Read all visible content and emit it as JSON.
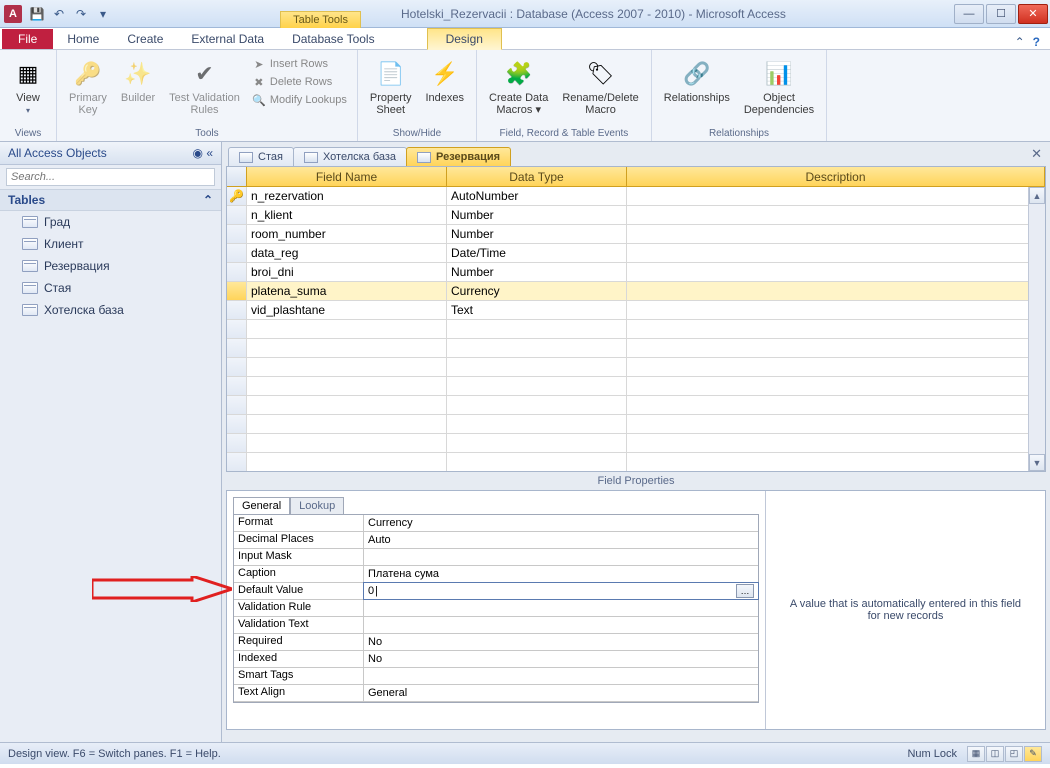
{
  "titlebar": {
    "app_letter": "A",
    "context_tool": "Table Tools",
    "title": "Hotelski_Rezervacii : Database (Access 2007 - 2010)  -  Microsoft Access"
  },
  "ribbon_tabs": {
    "file": "File",
    "home": "Home",
    "create": "Create",
    "external": "External Data",
    "dbtools": "Database Tools",
    "design": "Design"
  },
  "ribbon": {
    "views": {
      "view": "View",
      "group": "Views"
    },
    "tools": {
      "primary_key": "Primary\nKey",
      "builder": "Builder",
      "test_rules": "Test Validation\nRules",
      "insert_rows": "Insert Rows",
      "delete_rows": "Delete Rows",
      "modify_lookups": "Modify Lookups",
      "group": "Tools"
    },
    "showhide": {
      "property_sheet": "Property\nSheet",
      "indexes": "Indexes",
      "group": "Show/Hide"
    },
    "events": {
      "create_macros": "Create Data\nMacros ▾",
      "rename_delete": "Rename/Delete\nMacro",
      "group": "Field, Record & Table Events"
    },
    "relationships": {
      "relationships": "Relationships",
      "dependencies": "Object\nDependencies",
      "group": "Relationships"
    }
  },
  "nav": {
    "header": "All Access Objects",
    "search_placeholder": "Search...",
    "group": "Tables",
    "items": [
      "Град",
      "Клиент",
      "Резервация",
      "Стая",
      "Хотелска база"
    ]
  },
  "doc_tabs": [
    "Стая",
    "Хотелска база",
    "Резервация"
  ],
  "grid": {
    "headers": {
      "field_name": "Field Name",
      "data_type": "Data Type",
      "description": "Description"
    },
    "rows": [
      {
        "pk": true,
        "name": "n_rezervation",
        "type": "AutoNumber"
      },
      {
        "pk": false,
        "name": "n_klient",
        "type": "Number"
      },
      {
        "pk": false,
        "name": "room_number",
        "type": "Number"
      },
      {
        "pk": false,
        "name": "data_reg",
        "type": "Date/Time"
      },
      {
        "pk": false,
        "name": "broi_dni",
        "type": "Number"
      },
      {
        "pk": false,
        "name": "platena_suma",
        "type": "Currency",
        "selected": true
      },
      {
        "pk": false,
        "name": "vid_plashtane",
        "type": "Text"
      }
    ]
  },
  "field_props": {
    "title": "Field Properties",
    "tabs": {
      "general": "General",
      "lookup": "Lookup"
    },
    "rows": [
      {
        "k": "Format",
        "v": "Currency"
      },
      {
        "k": "Decimal Places",
        "v": "Auto"
      },
      {
        "k": "Input Mask",
        "v": ""
      },
      {
        "k": "Caption",
        "v": "Платена сума"
      },
      {
        "k": "Default Value",
        "v": "0",
        "active": true,
        "builder": true
      },
      {
        "k": "Validation Rule",
        "v": ""
      },
      {
        "k": "Validation Text",
        "v": ""
      },
      {
        "k": "Required",
        "v": "No"
      },
      {
        "k": "Indexed",
        "v": "No"
      },
      {
        "k": "Smart Tags",
        "v": ""
      },
      {
        "k": "Text Align",
        "v": "General"
      }
    ],
    "help": "A value that is automatically entered in this field for new records"
  },
  "statusbar": {
    "left": "Design view.  F6 = Switch panes.  F1 = Help.",
    "numlock": "Num Lock"
  }
}
